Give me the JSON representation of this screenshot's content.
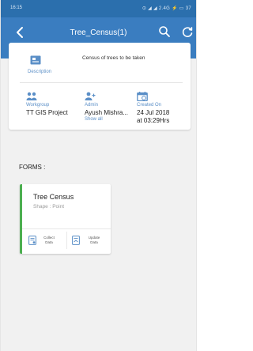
{
  "status_bar": {
    "time": "16:15",
    "indicators": "⊙ ◢ ◢ 2.4G ⚡ ▭ 37"
  },
  "app_bar": {
    "title": "Tree_Census(1)",
    "back_icon": "back-arrow-icon",
    "search_icon": "search-icon",
    "refresh_icon": "refresh-icon",
    "color": "#3a7dc0"
  },
  "project_card": {
    "description": {
      "label": "Description",
      "value": "Census of trees to be taken"
    },
    "workgroup": {
      "label": "Workgroup",
      "value": "TT GIS Project"
    },
    "admin": {
      "label": "Admin",
      "value": "Ayush Mishra...",
      "show_all": "Show all"
    },
    "created_on": {
      "label": "Created On",
      "date": "24 Jul 2018",
      "time": "at 03:29Hrs"
    }
  },
  "forms": {
    "heading": "FORMS :",
    "items": [
      {
        "title": "Tree Census",
        "shape": "Shape : Point",
        "accent": "#4caf50",
        "actions": [
          {
            "label_line1": "Collect",
            "label_line2": "Data",
            "icon": "collect-data-icon"
          },
          {
            "label_line1": "Update",
            "label_line2": "Data",
            "icon": "update-data-icon"
          }
        ]
      }
    ]
  }
}
